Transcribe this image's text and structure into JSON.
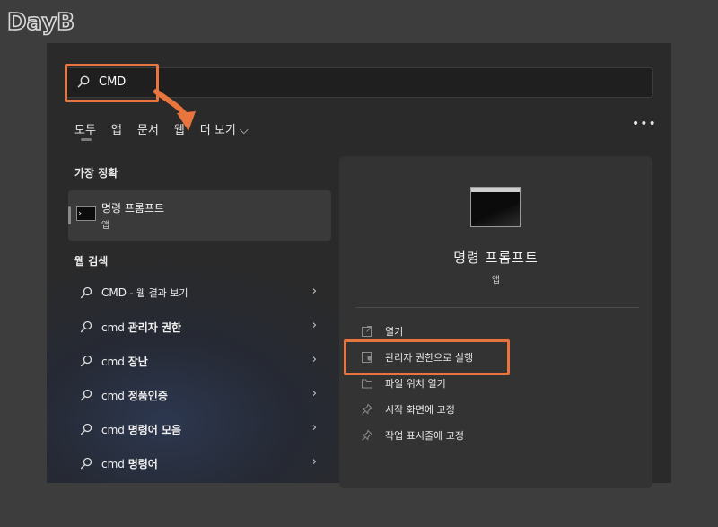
{
  "watermark": "DayB",
  "search": {
    "value": "CMD"
  },
  "tabs": [
    {
      "label": "모두"
    },
    {
      "label": "앱"
    },
    {
      "label": "문서"
    },
    {
      "label": "웹"
    },
    {
      "label": "더 보기 ⌵"
    }
  ],
  "more_menu": "•••",
  "best_match": {
    "heading": "가장 정확",
    "title": "명령 프롬프트",
    "subtitle": "앱"
  },
  "web_search": {
    "heading": "웹 검색",
    "results": [
      {
        "prefix": "CMD",
        "rest": " - 웹 결과 보기"
      },
      {
        "prefix": "cmd ",
        "rest": "관리자 권한"
      },
      {
        "prefix": "cmd ",
        "rest": "장난"
      },
      {
        "prefix": "cmd ",
        "rest": "정품인증"
      },
      {
        "prefix": "cmd ",
        "rest": "명령어 모음"
      },
      {
        "prefix": "cmd ",
        "rest": "명령어"
      }
    ]
  },
  "details": {
    "title": "명령 프롬프트",
    "subtitle": "앱",
    "actions": [
      {
        "label": "열기",
        "icon": "open-icon"
      },
      {
        "label": "관리자 권한으로 실행",
        "icon": "shield-icon"
      },
      {
        "label": "파일 위치 열기",
        "icon": "folder-icon"
      },
      {
        "label": "시작 화면에 고정",
        "icon": "pin-icon"
      },
      {
        "label": "작업 표시줄에 고정",
        "icon": "pin-icon"
      }
    ]
  },
  "colors": {
    "highlight": "#e8743e",
    "panel": "#2a2a2a",
    "background": "#3d3d3d"
  }
}
